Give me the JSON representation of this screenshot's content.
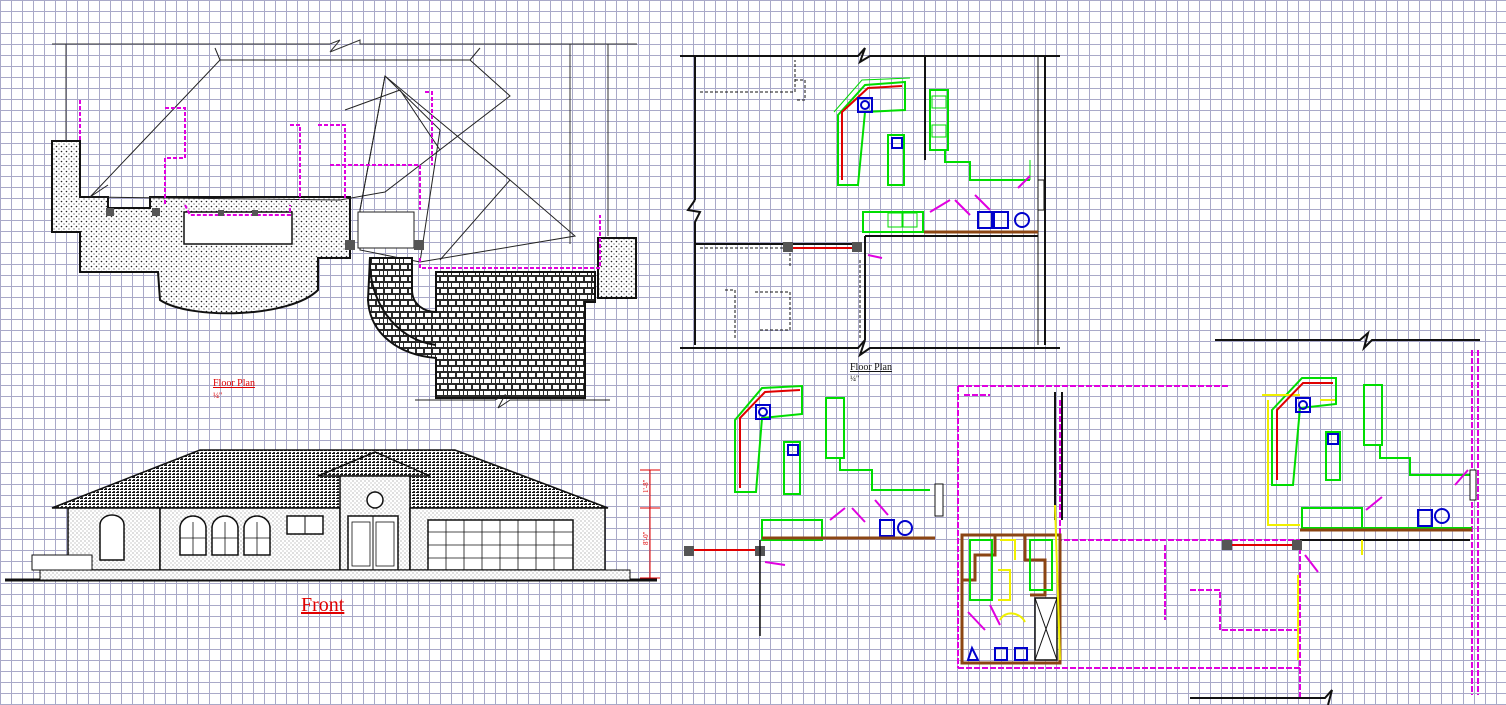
{
  "labels": {
    "floor_plan_1": "Floor Plan",
    "floor_plan_1_scale": "¼\"",
    "floor_plan_2": "Floor Plan",
    "floor_plan_2_scale": "¼\"",
    "front": "Front",
    "dim_upper": "1'-8\"",
    "dim_lower": "8'-0\""
  },
  "colors": {
    "grid": "#a9a9c8",
    "wall": "#1a1a1a",
    "cabinet": "#00dd00",
    "plumbing": "#e000e0",
    "outline_red": "#e00000",
    "appliance_blue": "#0000cc",
    "yellow": "#f0f000"
  }
}
